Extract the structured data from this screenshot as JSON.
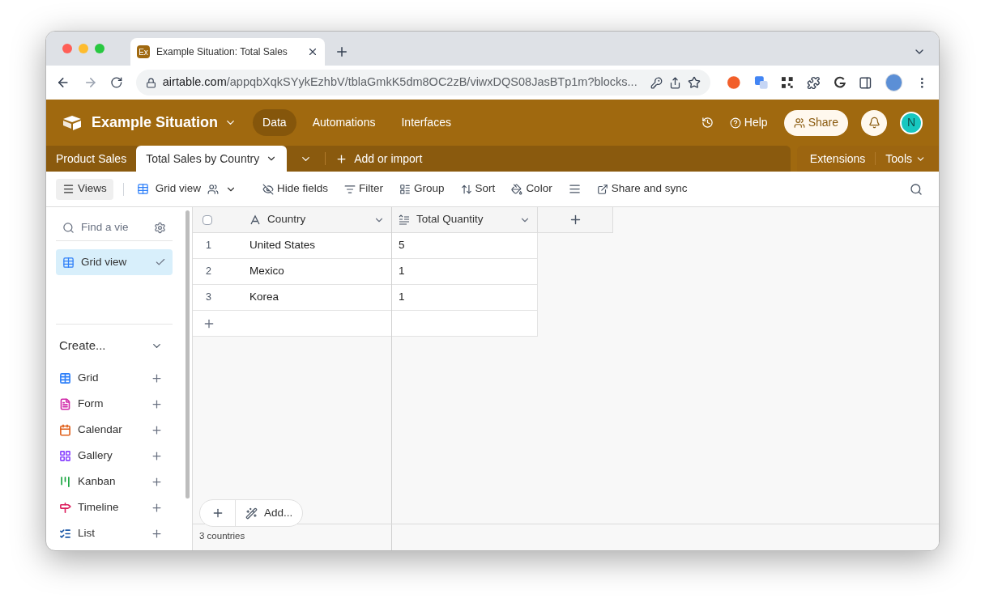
{
  "browser": {
    "tab_title": "Example Situation: Total Sales",
    "tab_favicon": "Ex",
    "url_domain": "airtable.com",
    "url_path": "/appqbXqkSYykEzhbV/tblaGmkK5dm8OC2zB/viwxDQS08JasBTp1m?blocks..."
  },
  "header": {
    "base_name": "Example Situation",
    "nav": [
      {
        "label": "Data",
        "selected": true
      },
      {
        "label": "Automations",
        "selected": false
      },
      {
        "label": "Interfaces",
        "selected": false
      }
    ],
    "help": "Help",
    "share": "Share",
    "avatar": "N"
  },
  "tables": [
    {
      "label": "Product Sales",
      "selected": false
    },
    {
      "label": "Total Sales by Country",
      "selected": true
    }
  ],
  "add_table": "Add or import",
  "right_tools": [
    {
      "label": "Extensions",
      "kind": "plain"
    },
    {
      "label": "Tools",
      "kind": "menu"
    }
  ],
  "view_bar": {
    "views": "Views",
    "view_name": "Grid view",
    "actions": [
      {
        "kind": "hide",
        "label": "Hide fields"
      },
      {
        "kind": "filter",
        "label": "Filter"
      },
      {
        "kind": "group",
        "label": "Group"
      },
      {
        "kind": "sort",
        "label": "Sort"
      },
      {
        "kind": "color",
        "label": "Color"
      },
      {
        "kind": "density"
      },
      {
        "kind": "share",
        "label": "Share and sync"
      }
    ]
  },
  "sidebar": {
    "search_placeholder": "Find a vie",
    "views": [
      {
        "label": "Grid view",
        "selected": true
      }
    ],
    "create_title": "Create...",
    "create_items": [
      {
        "kind": "grid",
        "label": "Grid",
        "color": "#2d7ff9"
      },
      {
        "kind": "form",
        "label": "Form",
        "color": "#d02aa9"
      },
      {
        "kind": "calendar",
        "label": "Calendar",
        "color": "#e0611b"
      },
      {
        "kind": "gallery",
        "label": "Gallery",
        "color": "#8b46ff"
      },
      {
        "kind": "kanban",
        "label": "Kanban",
        "color": "#11a33a"
      },
      {
        "kind": "timeline",
        "label": "Timeline",
        "color": "#dc1c5c"
      },
      {
        "kind": "list",
        "label": "List",
        "color": "#1e5aa8"
      }
    ]
  },
  "grid": {
    "select_all_checked": false,
    "columns": [
      {
        "kind": "text",
        "label": "Country"
      },
      {
        "kind": "rollup",
        "label": "Total Quantity"
      }
    ],
    "rows": [
      {
        "number": "1",
        "cells": [
          "United States",
          "5"
        ]
      },
      {
        "number": "2",
        "cells": [
          "Mexico",
          "1"
        ]
      },
      {
        "number": "3",
        "cells": [
          "Korea",
          "1"
        ]
      }
    ],
    "add_label": "Add...",
    "footer": "3 countries"
  }
}
